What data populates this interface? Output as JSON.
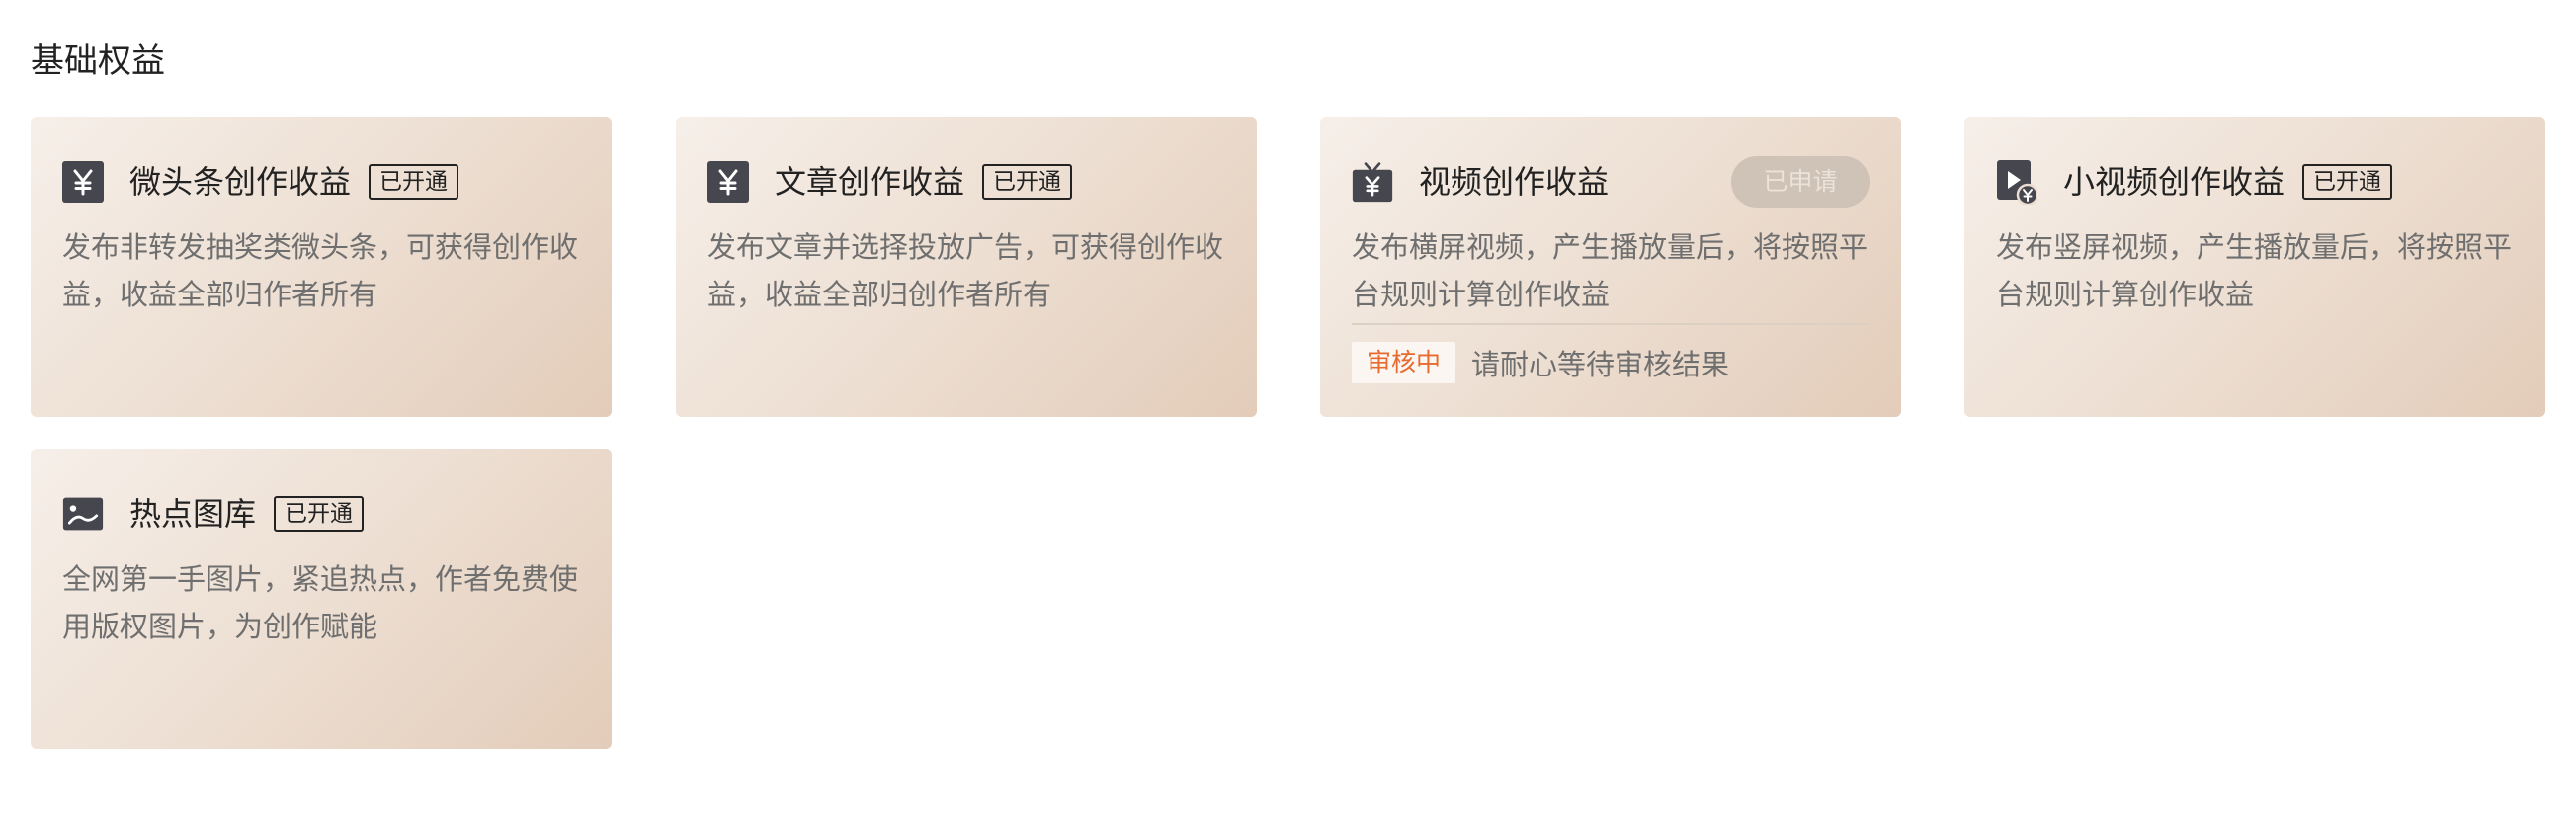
{
  "section": {
    "title": "基础权益"
  },
  "cards": [
    {
      "icon": "yen-icon",
      "title": "微头条创作收益",
      "badge": "已开通",
      "description": "发布非转发抽奖类微头条，可获得创作收益，收益全部归作者所有"
    },
    {
      "icon": "yen-icon",
      "title": "文章创作收益",
      "badge": "已开通",
      "description": "发布文章并选择投放广告，可获得创作收益，收益全部归创作者所有"
    },
    {
      "icon": "tv-yen-icon",
      "title": "视频创作收益",
      "action_label": "已申请",
      "description": "发布横屏视频，产生播放量后，将按照平台规则计算创作收益",
      "review": {
        "tag": "审核中",
        "text": "请耐心等待审核结果"
      }
    },
    {
      "icon": "short-video-yen-icon",
      "title": "小视频创作收益",
      "badge": "已开通",
      "description": "发布竖屏视频，产生播放量后，将按照平台规则计算创作收益"
    },
    {
      "icon": "image-icon",
      "title": "热点图库",
      "badge": "已开通",
      "description": "全网第一手图片，紧追热点，作者免费使用版权图片，为创作赋能"
    }
  ],
  "colors": {
    "card_gradient_start": "#f6efe9",
    "card_gradient_end": "#e3ccb9",
    "icon_dark": "#45464e",
    "review_tag_text": "#e76a2e",
    "apply_pill_bg": "#cfc2b6"
  }
}
